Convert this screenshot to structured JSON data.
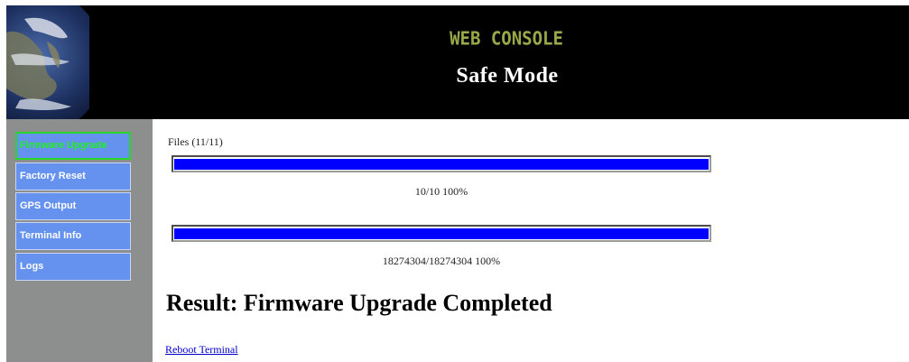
{
  "header": {
    "brand": "WEB CONSOLE",
    "mode": "Safe Mode"
  },
  "sidebar": {
    "items": [
      {
        "label": "Firmware Upgrade",
        "active": true
      },
      {
        "label": "Factory Reset"
      },
      {
        "label": "GPS Output"
      },
      {
        "label": "Terminal Info"
      },
      {
        "label": "Logs"
      }
    ]
  },
  "main": {
    "files_label": "Files (11/11)",
    "progress": [
      {
        "text": "10/10   100%",
        "percent": 100
      },
      {
        "text": "18274304/18274304   100%",
        "percent": 100
      }
    ],
    "result": "Result: Firmware Upgrade Completed",
    "reboot_link": "Reboot Terminal"
  },
  "colors": {
    "brand": "#9aa84a",
    "nav": "#6592ee",
    "active": "#22ee22",
    "progress_fill": "#0000ff"
  }
}
